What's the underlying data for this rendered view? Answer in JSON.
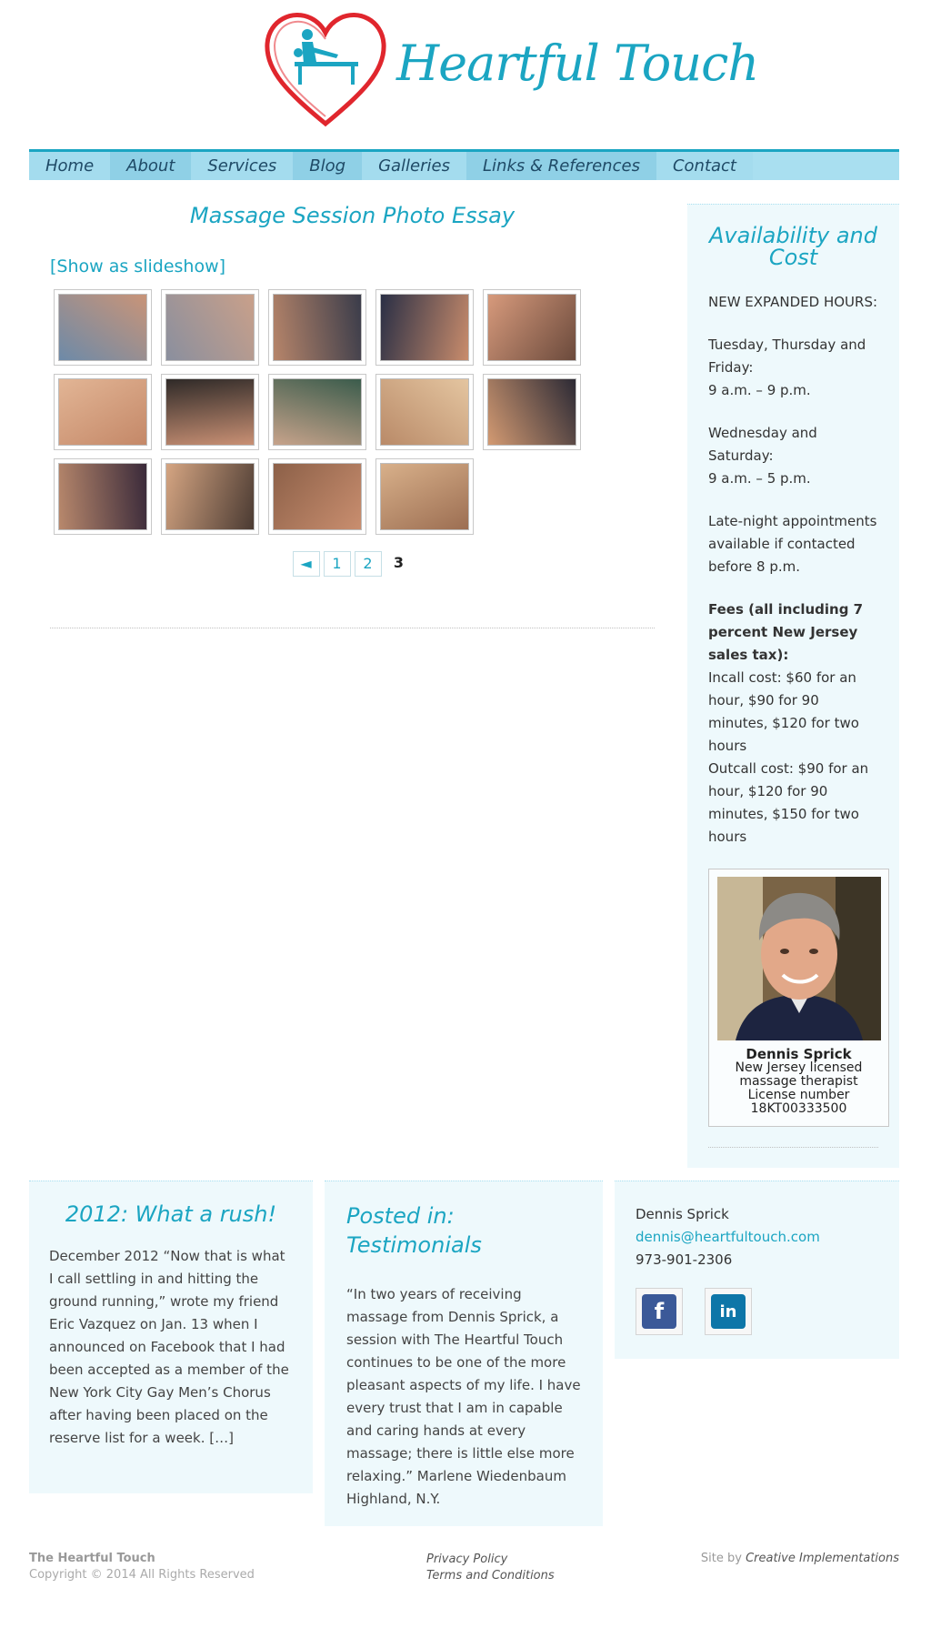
{
  "site": {
    "logo_text": "Heartful Touch",
    "colors": {
      "accent": "#1ba5c2",
      "nav_bg": "#a9dff0",
      "panel_bg": "#eef9fc",
      "heart": "#e0262d"
    }
  },
  "nav": {
    "items": [
      "Home",
      "About",
      "Services",
      "Blog",
      "Galleries",
      "Links & References",
      "Contact"
    ]
  },
  "main": {
    "title": "Massage Session Photo Essay",
    "slideshow_link": "[Show as slideshow]",
    "thumbnails": [
      {
        "alt": "massage-photo",
        "tone": [
          "#6d8aa8",
          "#c99478"
        ]
      },
      {
        "alt": "massage-photo",
        "tone": [
          "#8a8f9e",
          "#c9a08a"
        ]
      },
      {
        "alt": "massage-photo",
        "tone": [
          "#b7856a",
          "#3a3c4a"
        ]
      },
      {
        "alt": "massage-photo",
        "tone": [
          "#2a2f45",
          "#c98c6c"
        ]
      },
      {
        "alt": "massage-photo",
        "tone": [
          "#d79a7c",
          "#6b4a3c"
        ]
      },
      {
        "alt": "massage-photo",
        "tone": [
          "#e2b595",
          "#c48868"
        ]
      },
      {
        "alt": "massage-photo",
        "tone": [
          "#2f2a28",
          "#c99074"
        ]
      },
      {
        "alt": "massage-photo",
        "tone": [
          "#3b5c4c",
          "#c7a38b"
        ]
      },
      {
        "alt": "massage-photo",
        "tone": [
          "#e4c5a0",
          "#b98a68"
        ]
      },
      {
        "alt": "massage-photo",
        "tone": [
          "#2c2a35",
          "#d39a72"
        ]
      },
      {
        "alt": "massage-photo",
        "tone": [
          "#3a2a3a",
          "#b8886c"
        ]
      },
      {
        "alt": "massage-photo",
        "tone": [
          "#4a3a32",
          "#d5a582"
        ]
      },
      {
        "alt": "massage-photo",
        "tone": [
          "#c98e6f",
          "#8c6048"
        ]
      },
      {
        "alt": "massage-photo",
        "tone": [
          "#9c6e52",
          "#d8b08a"
        ]
      }
    ],
    "pager": {
      "prev": "◄",
      "pages": [
        "1",
        "2"
      ],
      "current": "3"
    }
  },
  "sidebar": {
    "title": "Availability and Cost",
    "hours_heading": "NEW EXPANDED HOURS:",
    "hours_1": "Tuesday, Thursday and\nFriday:\n9 a.m. – 9 p.m.",
    "hours_2": "Wednesday and\nSaturday:\n9 a.m. – 5 p.m.",
    "late_night": "Late-night appointments\navailable if  contacted\nbefore 8 p.m.",
    "fees_heading": "Fees (all including 7\npercent New Jersey\nsales tax):",
    "incall": "Incall cost: $60 for an\nhour, $90 for 90\nminutes, $120 for two\nhours",
    "outcall": "Outcall cost: $90 for an\nhour, $120 for 90\nminutes, $150 for two\nhours",
    "profile": {
      "name": "Dennis Sprick",
      "line1": "New Jersey licensed",
      "line2": "massage therapist",
      "line3": "License number",
      "line4": "18KT00333500"
    }
  },
  "widgets": {
    "blog": {
      "title": "2012: What a rush!",
      "text": "December 2012 “Now that is what I call settling in and hitting the ground running,” wrote my friend Eric Vazquez on Jan. 13 when I announced on Facebook that I had been accepted as a member of the New York City Gay Men’s Chorus after having been placed on the reserve list for a week. […]"
    },
    "testimonial": {
      "title": "Posted in: Testimonials",
      "text": "“In two years of receiving massage from Dennis Sprick, a session with The Heartful Touch continues to be one of the more pleasant aspects of my life. I have every trust that I am in capable and caring hands at every massage; there is little else more relaxing.” Marlene Wiedenbaum Highland, N.Y."
    },
    "contact": {
      "name": "Dennis Sprick",
      "email": "dennis@heartfultouch.com",
      "phone": "973-901-2306",
      "social": [
        {
          "label": "f",
          "icon": "facebook-icon",
          "color": "#3b5998"
        },
        {
          "label": "in",
          "icon": "linkedin-icon",
          "color": "#0e76a8"
        }
      ]
    }
  },
  "footer": {
    "brand": "The Heartful Touch",
    "copyright": "Copyright © 2014 All Rights Reserved",
    "privacy": "Privacy Policy",
    "terms": "Terms and Conditions",
    "credit_prefix": "Site by ",
    "credit_link": "Creative Implementations"
  }
}
